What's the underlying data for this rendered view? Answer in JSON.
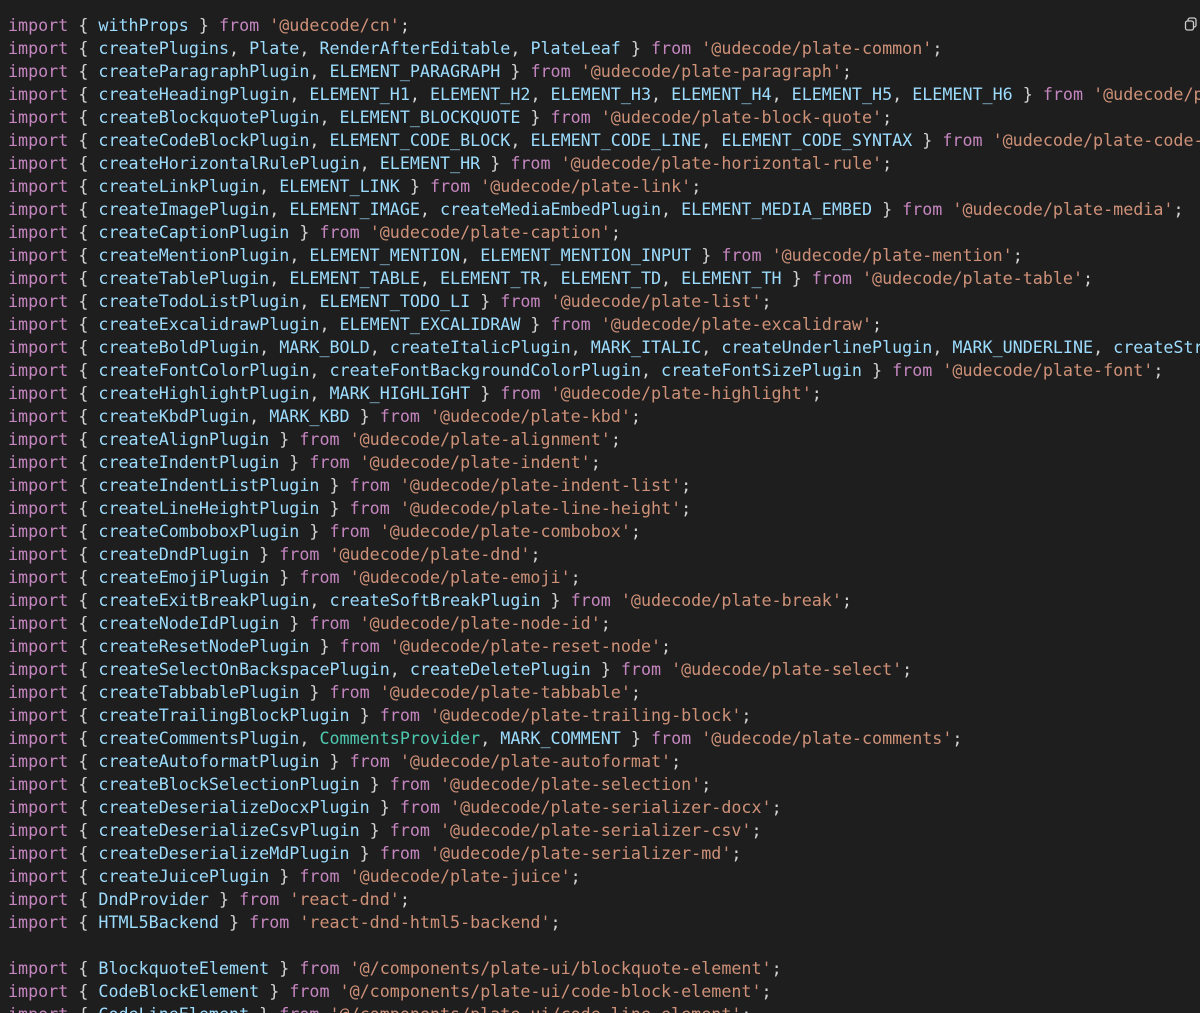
{
  "import_keyword": "import",
  "from_keyword": "from",
  "copy_button": {
    "icon": "copy-icon"
  },
  "colors": {
    "background": "#1e1e1e",
    "keyword": "#c586c0",
    "identifier": "#9cdcfe",
    "component": "#4ec9b0",
    "string": "#ce9178"
  },
  "lines": [
    {
      "names": [
        [
          "withProps"
        ]
      ],
      "source": "'@udecode/cn'",
      "end": ";"
    },
    {
      "names": [
        [
          "createPlugins"
        ],
        [
          "Plate"
        ],
        [
          "RenderAfterEditable"
        ],
        [
          "PlateLeaf"
        ]
      ],
      "source": "'@udecode/plate-common'",
      "end": ";"
    },
    {
      "names": [
        [
          "createParagraphPlugin"
        ],
        [
          "ELEMENT_PARAGRAPH"
        ]
      ],
      "source": "'@udecode/plate-paragraph'",
      "end": ";"
    },
    {
      "names": [
        [
          "createHeadingPlugin"
        ],
        [
          "ELEMENT_H1"
        ],
        [
          "ELEMENT_H2"
        ],
        [
          "ELEMENT_H3"
        ],
        [
          "ELEMENT_H4"
        ],
        [
          "ELEMENT_H5"
        ],
        [
          "ELEMENT_H6"
        ]
      ],
      "source": "'@udecode/plate-headin",
      "end": ""
    },
    {
      "names": [
        [
          "createBlockquotePlugin"
        ],
        [
          "ELEMENT_BLOCKQUOTE"
        ]
      ],
      "source": "'@udecode/plate-block-quote'",
      "end": ";"
    },
    {
      "names": [
        [
          "createCodeBlockPlugin"
        ],
        [
          "ELEMENT_CODE_BLOCK"
        ],
        [
          "ELEMENT_CODE_LINE"
        ],
        [
          "ELEMENT_CODE_SYNTAX"
        ]
      ],
      "source": "'@udecode/plate-code-block'",
      "end": ";"
    },
    {
      "names": [
        [
          "createHorizontalRulePlugin"
        ],
        [
          "ELEMENT_HR"
        ]
      ],
      "source": "'@udecode/plate-horizontal-rule'",
      "end": ";"
    },
    {
      "names": [
        [
          "createLinkPlugin"
        ],
        [
          "ELEMENT_LINK"
        ]
      ],
      "source": "'@udecode/plate-link'",
      "end": ";"
    },
    {
      "names": [
        [
          "createImagePlugin"
        ],
        [
          "ELEMENT_IMAGE"
        ],
        [
          "createMediaEmbedPlugin"
        ],
        [
          "ELEMENT_MEDIA_EMBED"
        ]
      ],
      "source": "'@udecode/plate-media'",
      "end": ";"
    },
    {
      "names": [
        [
          "createCaptionPlugin"
        ]
      ],
      "source": "'@udecode/plate-caption'",
      "end": ";"
    },
    {
      "names": [
        [
          "createMentionPlugin"
        ],
        [
          "ELEMENT_MENTION"
        ],
        [
          "ELEMENT_MENTION_INPUT"
        ]
      ],
      "source": "'@udecode/plate-mention'",
      "end": ";"
    },
    {
      "names": [
        [
          "createTablePlugin"
        ],
        [
          "ELEMENT_TABLE"
        ],
        [
          "ELEMENT_TR"
        ],
        [
          "ELEMENT_TD"
        ],
        [
          "ELEMENT_TH"
        ]
      ],
      "source": "'@udecode/plate-table'",
      "end": ";"
    },
    {
      "names": [
        [
          "createTodoListPlugin"
        ],
        [
          "ELEMENT_TODO_LI"
        ]
      ],
      "source": "'@udecode/plate-list'",
      "end": ";"
    },
    {
      "names": [
        [
          "createExcalidrawPlugin"
        ],
        [
          "ELEMENT_EXCALIDRAW"
        ]
      ],
      "source": "'@udecode/plate-excalidraw'",
      "end": ";"
    },
    {
      "names": [
        [
          "createBoldPlugin"
        ],
        [
          "MARK_BOLD"
        ],
        [
          "createItalicPlugin"
        ],
        [
          "MARK_ITALIC"
        ],
        [
          "createUnderlinePlugin"
        ],
        [
          "MARK_UNDERLINE"
        ],
        [
          "createStrikethroughP"
        ]
      ],
      "source": "",
      "end": "",
      "cut": true
    },
    {
      "names": [
        [
          "createFontColorPlugin"
        ],
        [
          "createFontBackgroundColorPlugin"
        ],
        [
          "createFontSizePlugin"
        ]
      ],
      "source": "'@udecode/plate-font'",
      "end": ";"
    },
    {
      "names": [
        [
          "createHighlightPlugin"
        ],
        [
          "MARK_HIGHLIGHT"
        ]
      ],
      "source": "'@udecode/plate-highlight'",
      "end": ";"
    },
    {
      "names": [
        [
          "createKbdPlugin"
        ],
        [
          "MARK_KBD"
        ]
      ],
      "source": "'@udecode/plate-kbd'",
      "end": ";"
    },
    {
      "names": [
        [
          "createAlignPlugin"
        ]
      ],
      "source": "'@udecode/plate-alignment'",
      "end": ";"
    },
    {
      "names": [
        [
          "createIndentPlugin"
        ]
      ],
      "source": "'@udecode/plate-indent'",
      "end": ";"
    },
    {
      "names": [
        [
          "createIndentListPlugin"
        ]
      ],
      "source": "'@udecode/plate-indent-list'",
      "end": ";"
    },
    {
      "names": [
        [
          "createLineHeightPlugin"
        ]
      ],
      "source": "'@udecode/plate-line-height'",
      "end": ";"
    },
    {
      "names": [
        [
          "createComboboxPlugin"
        ]
      ],
      "source": "'@udecode/plate-combobox'",
      "end": ";"
    },
    {
      "names": [
        [
          "createDndPlugin"
        ]
      ],
      "source": "'@udecode/plate-dnd'",
      "end": ";"
    },
    {
      "names": [
        [
          "createEmojiPlugin"
        ]
      ],
      "source": "'@udecode/plate-emoji'",
      "end": ";"
    },
    {
      "names": [
        [
          "createExitBreakPlugin"
        ],
        [
          "createSoftBreakPlugin"
        ]
      ],
      "source": "'@udecode/plate-break'",
      "end": ";"
    },
    {
      "names": [
        [
          "createNodeIdPlugin"
        ]
      ],
      "source": "'@udecode/plate-node-id'",
      "end": ";"
    },
    {
      "names": [
        [
          "createResetNodePlugin"
        ]
      ],
      "source": "'@udecode/plate-reset-node'",
      "end": ";"
    },
    {
      "names": [
        [
          "createSelectOnBackspacePlugin"
        ],
        [
          "createDeletePlugin"
        ]
      ],
      "source": "'@udecode/plate-select'",
      "end": ";"
    },
    {
      "names": [
        [
          "createTabbablePlugin"
        ]
      ],
      "source": "'@udecode/plate-tabbable'",
      "end": ";"
    },
    {
      "names": [
        [
          "createTrailingBlockPlugin"
        ]
      ],
      "source": "'@udecode/plate-trailing-block'",
      "end": ";"
    },
    {
      "names": [
        [
          "createCommentsPlugin"
        ],
        [
          "CommentsProvider",
          "tp"
        ],
        [
          "MARK_COMMENT"
        ]
      ],
      "source": "'@udecode/plate-comments'",
      "end": ";"
    },
    {
      "names": [
        [
          "createAutoformatPlugin"
        ]
      ],
      "source": "'@udecode/plate-autoformat'",
      "end": ";"
    },
    {
      "names": [
        [
          "createBlockSelectionPlugin"
        ]
      ],
      "source": "'@udecode/plate-selection'",
      "end": ";"
    },
    {
      "names": [
        [
          "createDeserializeDocxPlugin"
        ]
      ],
      "source": "'@udecode/plate-serializer-docx'",
      "end": ";"
    },
    {
      "names": [
        [
          "createDeserializeCsvPlugin"
        ]
      ],
      "source": "'@udecode/plate-serializer-csv'",
      "end": ";"
    },
    {
      "names": [
        [
          "createDeserializeMdPlugin"
        ]
      ],
      "source": "'@udecode/plate-serializer-md'",
      "end": ";"
    },
    {
      "names": [
        [
          "createJuicePlugin"
        ]
      ],
      "source": "'@udecode/plate-juice'",
      "end": ";"
    },
    {
      "names": [
        [
          "DndProvider"
        ]
      ],
      "source": "'react-dnd'",
      "end": ";"
    },
    {
      "names": [
        [
          "HTML5Backend"
        ]
      ],
      "source": "'react-dnd-html5-backend'",
      "end": ";"
    },
    {
      "blank": true
    },
    {
      "names": [
        [
          "BlockquoteElement"
        ]
      ],
      "source": "'@/components/plate-ui/blockquote-element'",
      "end": ";"
    },
    {
      "names": [
        [
          "CodeBlockElement"
        ]
      ],
      "source": "'@/components/plate-ui/code-block-element'",
      "end": ";"
    },
    {
      "names": [
        [
          "CodeLineElement"
        ]
      ],
      "source": "'@/components/plate-ui/code-line-element'",
      "end": ";"
    }
  ]
}
